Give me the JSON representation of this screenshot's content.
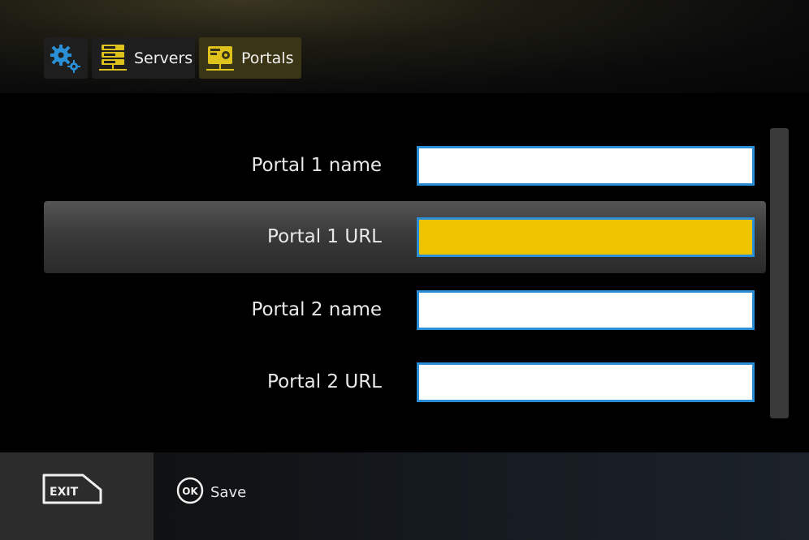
{
  "breadcrumb": {
    "items": [
      {
        "icon": "gear-icon",
        "label": ""
      },
      {
        "icon": "server-icon",
        "label": "Servers"
      },
      {
        "icon": "portal-icon",
        "label": "Portals"
      }
    ]
  },
  "form": {
    "rows": [
      {
        "label": "Portal 1 name",
        "value": "",
        "selected": false
      },
      {
        "label": "Portal 1 URL",
        "value": "",
        "selected": true
      },
      {
        "label": "Portal 2 name",
        "value": "",
        "selected": false
      },
      {
        "label": "Portal 2 URL",
        "value": "",
        "selected": false
      }
    ]
  },
  "footer": {
    "exit_key": "EXIT",
    "ok_key": "OK",
    "save_label": "Save"
  },
  "colors": {
    "accent_yellow": "#eec400",
    "input_border": "#2a8fd6",
    "gear_blue": "#2a8fd6"
  }
}
